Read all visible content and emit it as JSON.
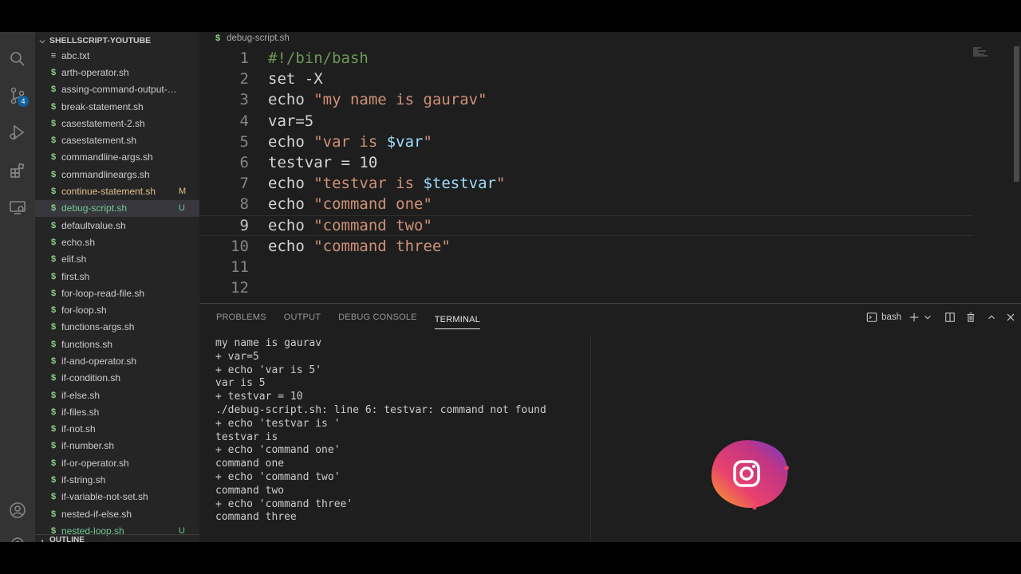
{
  "sidebar": {
    "title": "SHELLSCRIPT-YOUTUBE",
    "files": [
      {
        "name": "abc.txt",
        "type": "txt",
        "status": ""
      },
      {
        "name": "arth-operator.sh",
        "type": "sh",
        "status": ""
      },
      {
        "name": "assing-command-output-to-...",
        "type": "sh",
        "status": ""
      },
      {
        "name": "break-statement.sh",
        "type": "sh",
        "status": ""
      },
      {
        "name": "casestatement-2.sh",
        "type": "sh",
        "status": ""
      },
      {
        "name": "casestatement.sh",
        "type": "sh",
        "status": ""
      },
      {
        "name": "commandline-args.sh",
        "type": "sh",
        "status": ""
      },
      {
        "name": "commandlineargs.sh",
        "type": "sh",
        "status": ""
      },
      {
        "name": "continue-statement.sh",
        "type": "sh",
        "status": "M"
      },
      {
        "name": "debug-script.sh",
        "type": "sh",
        "status": "U"
      },
      {
        "name": "defaultvalue.sh",
        "type": "sh",
        "status": ""
      },
      {
        "name": "echo.sh",
        "type": "sh",
        "status": ""
      },
      {
        "name": "elif.sh",
        "type": "sh",
        "status": ""
      },
      {
        "name": "first.sh",
        "type": "sh",
        "status": ""
      },
      {
        "name": "for-loop-read-file.sh",
        "type": "sh",
        "status": ""
      },
      {
        "name": "for-loop.sh",
        "type": "sh",
        "status": ""
      },
      {
        "name": "functions-args.sh",
        "type": "sh",
        "status": ""
      },
      {
        "name": "functions.sh",
        "type": "sh",
        "status": ""
      },
      {
        "name": "if-and-operator.sh",
        "type": "sh",
        "status": ""
      },
      {
        "name": "if-condition.sh",
        "type": "sh",
        "status": ""
      },
      {
        "name": "if-else.sh",
        "type": "sh",
        "status": ""
      },
      {
        "name": "if-files.sh",
        "type": "sh",
        "status": ""
      },
      {
        "name": "if-not.sh",
        "type": "sh",
        "status": ""
      },
      {
        "name": "if-number.sh",
        "type": "sh",
        "status": ""
      },
      {
        "name": "if-or-operator.sh",
        "type": "sh",
        "status": ""
      },
      {
        "name": "if-string.sh",
        "type": "sh",
        "status": ""
      },
      {
        "name": "if-variable-not-set.sh",
        "type": "sh",
        "status": ""
      },
      {
        "name": "nested-if-else.sh",
        "type": "sh",
        "status": ""
      },
      {
        "name": "nested-loop.sh",
        "type": "sh",
        "status": "U"
      }
    ],
    "active_file": "debug-script.sh",
    "outline_label": "OUTLINE"
  },
  "activity_bar": {
    "icons": [
      "explorer-icon",
      "source-control-icon",
      "run-debug-icon",
      "extensions-icon",
      "remote-explorer-icon",
      "account-icon",
      "settings-icon"
    ],
    "source_control_badge": "4"
  },
  "editor": {
    "breadcrumb_icon": "$",
    "breadcrumb": "debug-script.sh",
    "current_line": 9,
    "lines": [
      {
        "num": "1",
        "tokens": [
          {
            "t": "comment",
            "v": "#!/bin/bash"
          }
        ]
      },
      {
        "num": "2",
        "tokens": [
          {
            "t": "plain",
            "v": "set -X"
          }
        ]
      },
      {
        "num": "3",
        "tokens": [
          {
            "t": "plain",
            "v": "echo "
          },
          {
            "t": "str",
            "v": "\"my name is gaurav\""
          }
        ]
      },
      {
        "num": "4",
        "tokens": [
          {
            "t": "plain",
            "v": "var=5"
          }
        ]
      },
      {
        "num": "5",
        "tokens": [
          {
            "t": "plain",
            "v": "echo "
          },
          {
            "t": "str",
            "v": "\"var is "
          },
          {
            "t": "var",
            "v": "$var"
          },
          {
            "t": "str",
            "v": "\""
          }
        ]
      },
      {
        "num": "6",
        "tokens": [
          {
            "t": "plain",
            "v": "testvar = 10"
          }
        ]
      },
      {
        "num": "7",
        "tokens": [
          {
            "t": "plain",
            "v": "echo "
          },
          {
            "t": "str",
            "v": "\"testvar is "
          },
          {
            "t": "var",
            "v": "$testvar"
          },
          {
            "t": "str",
            "v": "\""
          }
        ]
      },
      {
        "num": "8",
        "tokens": [
          {
            "t": "plain",
            "v": "echo "
          },
          {
            "t": "str",
            "v": "\"command one\""
          }
        ]
      },
      {
        "num": "9",
        "tokens": [
          {
            "t": "plain",
            "v": "echo "
          },
          {
            "t": "str",
            "v": "\"command two\""
          }
        ]
      },
      {
        "num": "10",
        "tokens": [
          {
            "t": "plain",
            "v": "echo "
          },
          {
            "t": "str",
            "v": "\"command three\""
          }
        ]
      },
      {
        "num": "11",
        "tokens": []
      },
      {
        "num": "12",
        "tokens": []
      }
    ]
  },
  "panel": {
    "tabs": [
      "PROBLEMS",
      "OUTPUT",
      "DEBUG CONSOLE",
      "TERMINAL"
    ],
    "active_tab": "TERMINAL",
    "terminal_name": "bash",
    "terminal_lines": [
      "my name is gaurav",
      "+ var=5",
      "+ echo 'var is 5'",
      "var is 5",
      "+ testvar = 10",
      "./debug-script.sh: line 6: testvar: command not found",
      "+ echo 'testvar is '",
      "testvar is",
      "+ echo 'command one'",
      "command one",
      "+ echo 'command two'",
      "command two",
      "+ echo 'command three'",
      "command three"
    ]
  },
  "colors": {
    "editor_bg": "#1e1e1e",
    "sidebar_bg": "#252526",
    "activity_bg": "#333333",
    "string": "#ce9178",
    "variable": "#9cdcfe",
    "comment": "#6a9955",
    "modified": "#e2c08d",
    "untracked": "#73c991"
  }
}
